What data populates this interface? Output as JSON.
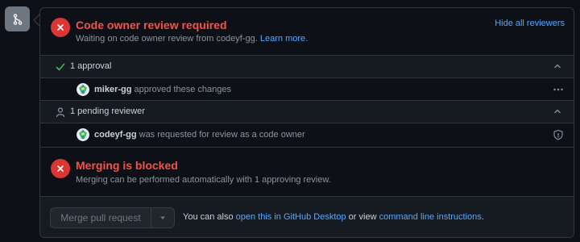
{
  "review": {
    "title": "Code owner review required",
    "subtitle_prefix": "Waiting on code owner review from codeyf-gg. ",
    "learn_more": "Learn more.",
    "hide_reviewers": "Hide all reviewers"
  },
  "approvals": {
    "header": "1 approval",
    "rows": [
      {
        "name": "miker-gg",
        "action": "approved these changes"
      }
    ]
  },
  "pending": {
    "header": "1 pending reviewer",
    "rows": [
      {
        "name": "codeyf-gg",
        "action": "was requested for review as a code owner"
      }
    ]
  },
  "merge_status": {
    "title": "Merging is blocked",
    "subtitle": "Merging can be performed automatically with 1 approving review."
  },
  "merge_box": {
    "button": "Merge pull request",
    "note_prefix": "You can also ",
    "desktop_link": "open this in GitHub Desktop",
    "note_middle": " or view ",
    "cli_link": "command line instructions",
    "note_suffix": "."
  },
  "icons": {
    "timeline": "git-branch-icon",
    "error": "x-circle-icon",
    "check": "check-icon",
    "person": "person-icon",
    "chevron": "chevron-up-icon",
    "kebab": "kebab-horizontal-icon",
    "shield": "shield-lock-icon",
    "dropdown": "triangle-down-icon"
  },
  "colors": {
    "danger": "#f85149",
    "danger_bg": "#da3633",
    "link": "#58a6ff",
    "success": "#3fb950",
    "muted": "#8b949e",
    "border": "#30363d"
  }
}
